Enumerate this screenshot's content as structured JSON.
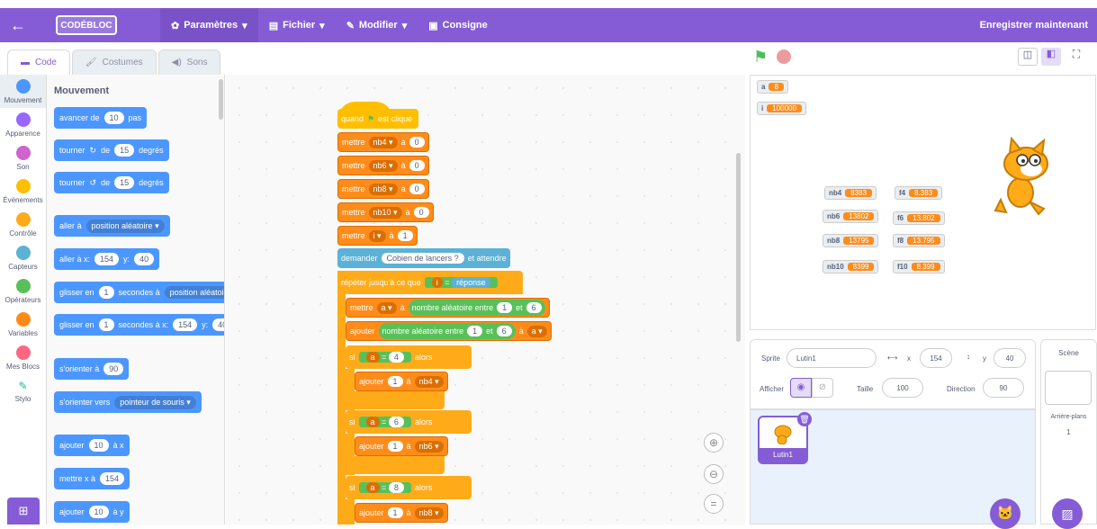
{
  "menubar": {
    "logo": "CODÉBLOC",
    "settings": "Paramètres",
    "file": "Fichier",
    "edit": "Modifier",
    "instructions": "Consigne",
    "save": "Enregistrer maintenant"
  },
  "tabs": {
    "code": "Code",
    "costumes": "Costumes",
    "sounds": "Sons"
  },
  "categories": [
    {
      "label": "Mouvement",
      "color": "#4c97ff"
    },
    {
      "label": "Apparence",
      "color": "#9966ff"
    },
    {
      "label": "Son",
      "color": "#cf63cf"
    },
    {
      "label": "Événements",
      "color": "#ffbf00"
    },
    {
      "label": "Contrôle",
      "color": "#ffab19"
    },
    {
      "label": "Capteurs",
      "color": "#5cb1d6"
    },
    {
      "label": "Opérateurs",
      "color": "#59c059"
    },
    {
      "label": "Variables",
      "color": "#ff8c1a"
    },
    {
      "label": "Mes Blocs",
      "color": "#ff6680"
    },
    {
      "label": "Stylo",
      "color": "#0fbd8c"
    }
  ],
  "palette": {
    "title": "Mouvement",
    "move": [
      "avancer de",
      "10",
      "pas"
    ],
    "turn_right": [
      "tourner",
      "de",
      "15",
      "degrés"
    ],
    "turn_left": [
      "tourner",
      "de",
      "15",
      "degrés"
    ],
    "goto": [
      "aller à",
      "position aléatoire"
    ],
    "goto_xy": [
      "aller à x:",
      "154",
      "y:",
      "40"
    ],
    "glide": [
      "glisser en",
      "1",
      "secondes à",
      "position aléatoi"
    ],
    "glide_xy": [
      "glisser en",
      "1",
      "secondes à x:",
      "154",
      "y:",
      "40"
    ],
    "point": [
      "s'orienter à",
      "90"
    ],
    "point_towards": [
      "s'orienter vers",
      "pointeur de souris"
    ],
    "change_x": [
      "ajouter",
      "10",
      "à x"
    ],
    "set_x": [
      "mettre x à",
      "154"
    ],
    "change_y": [
      "ajouter",
      "10",
      "à y"
    ]
  },
  "script": {
    "hat": [
      "quand",
      "est cliqué"
    ],
    "set1": [
      "mettre",
      "nb4",
      "à",
      "0"
    ],
    "set2": [
      "mettre",
      "nb6",
      "à",
      "0"
    ],
    "set3": [
      "mettre",
      "nb8",
      "à",
      "0"
    ],
    "set4": [
      "mettre",
      "nb10",
      "à",
      "0"
    ],
    "set5": [
      "mettre",
      "i",
      "à",
      "1"
    ],
    "ask": [
      "demander",
      "Cobien de lancers ?",
      "et attendre"
    ],
    "repeat": [
      "répéter jusqu'à ce que",
      "i",
      "=",
      "réponse"
    ],
    "set_a": [
      "mettre",
      "a",
      "à",
      "nombre aléatoire entre",
      "1",
      "et",
      "6"
    ],
    "add_rand": [
      "ajouter",
      "nombre aléatoire entre",
      "1",
      "et",
      "6",
      "à",
      "a"
    ],
    "if1": [
      "si",
      "a",
      "=",
      "4",
      "alors"
    ],
    "inc1": [
      "ajouter",
      "1",
      "à",
      "nb4"
    ],
    "if2": [
      "si",
      "a",
      "=",
      "6",
      "alors"
    ],
    "inc2": [
      "ajouter",
      "1",
      "à",
      "nb6"
    ],
    "if3": [
      "si",
      "a",
      "=",
      "8",
      "alors"
    ],
    "inc3": [
      "ajouter",
      "1",
      "à",
      "nb8"
    ]
  },
  "monitors": {
    "a": [
      "a",
      "8"
    ],
    "i": [
      "i",
      "100000"
    ],
    "nb4": [
      "nb4",
      "8383"
    ],
    "f4": [
      "f4",
      "8.383"
    ],
    "nb6": [
      "nb6",
      "13802"
    ],
    "f6": [
      "f6",
      "13.802"
    ],
    "nb8": [
      "nb8",
      "13795"
    ],
    "f8": [
      "f8",
      "13.795"
    ],
    "nb10": [
      "nb10",
      "8399"
    ],
    "f10": [
      "f10",
      "8.399"
    ]
  },
  "sprite_info": {
    "sprite_label": "Sprite",
    "sprite_name": "Lutin1",
    "x_label": "x",
    "x": "154",
    "y_label": "y",
    "y": "40",
    "show_label": "Afficher",
    "size_label": "Taille",
    "size": "100",
    "direction_label": "Direction",
    "direction": "90"
  },
  "sprite_tile": "Lutin1",
  "scene": {
    "title": "Scène",
    "backdrops_label": "Arrière-plans",
    "backdrops_count": "1"
  }
}
